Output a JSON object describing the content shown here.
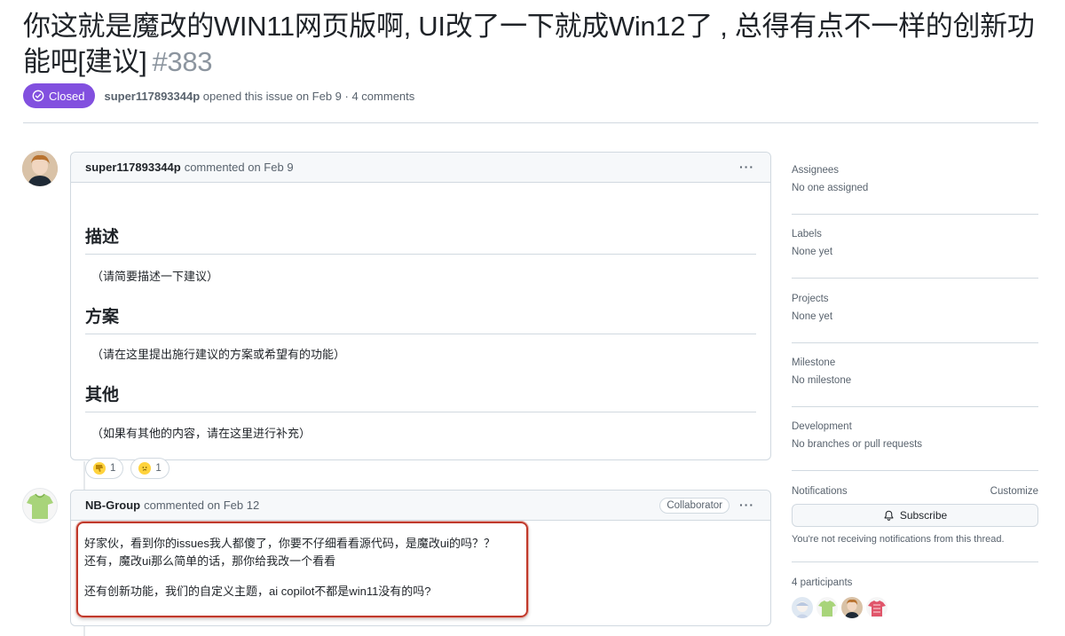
{
  "issue": {
    "title_line1": "你这就是魔改的WIN11网页版啊, UI改了一下就成Win12了 , 总得有点不一样的创新功",
    "title_line2": "能吧[建议]",
    "number": "#383",
    "state": "Closed",
    "state_color": "#8250df",
    "author": "super117893344p",
    "meta_text": "opened this issue on Feb 9 · 4 comments"
  },
  "comments": [
    {
      "author": "super117893344p",
      "meta": "commented on Feb 9",
      "menu": "···",
      "sections": [
        {
          "heading": "描述",
          "text": "（请简要描述一下建议）"
        },
        {
          "heading": "方案",
          "text": "（请在这里提出施行建议的方案或希望有的功能）"
        },
        {
          "heading": "其他",
          "text": "（如果有其他的内容，请在这里进行补充）"
        }
      ],
      "reactions": [
        {
          "icon": "thumbs-down-icon",
          "count": "1"
        },
        {
          "icon": "confused-face-icon",
          "count": "1"
        }
      ]
    },
    {
      "author": "NB-Group",
      "meta": "commented on Feb 12",
      "badge": "Collaborator",
      "menu": "···",
      "lines": [
        "好家伙，看到你的issues我人都傻了，你要不仔细看看源代码，是魔改ui的吗？？",
        "还有，魔改ui那么简单的话，那你给我改一个看看",
        "还有创新功能，我们的自定义主题，ai copilot不都是win11没有的吗?"
      ],
      "highlight_color": "#c0392b"
    }
  ],
  "sidebar": {
    "assignees": {
      "title": "Assignees",
      "value": "No one assigned"
    },
    "labels": {
      "title": "Labels",
      "value": "None yet"
    },
    "projects": {
      "title": "Projects",
      "value": "None yet"
    },
    "milestone": {
      "title": "Milestone",
      "value": "No milestone"
    },
    "development": {
      "title": "Development",
      "value": "No branches or pull requests"
    },
    "notifications": {
      "title": "Notifications",
      "customize": "Customize",
      "subscribe": "Subscribe",
      "note": "You're not receiving notifications from this thread."
    },
    "participants": {
      "title": "4 participants"
    }
  }
}
